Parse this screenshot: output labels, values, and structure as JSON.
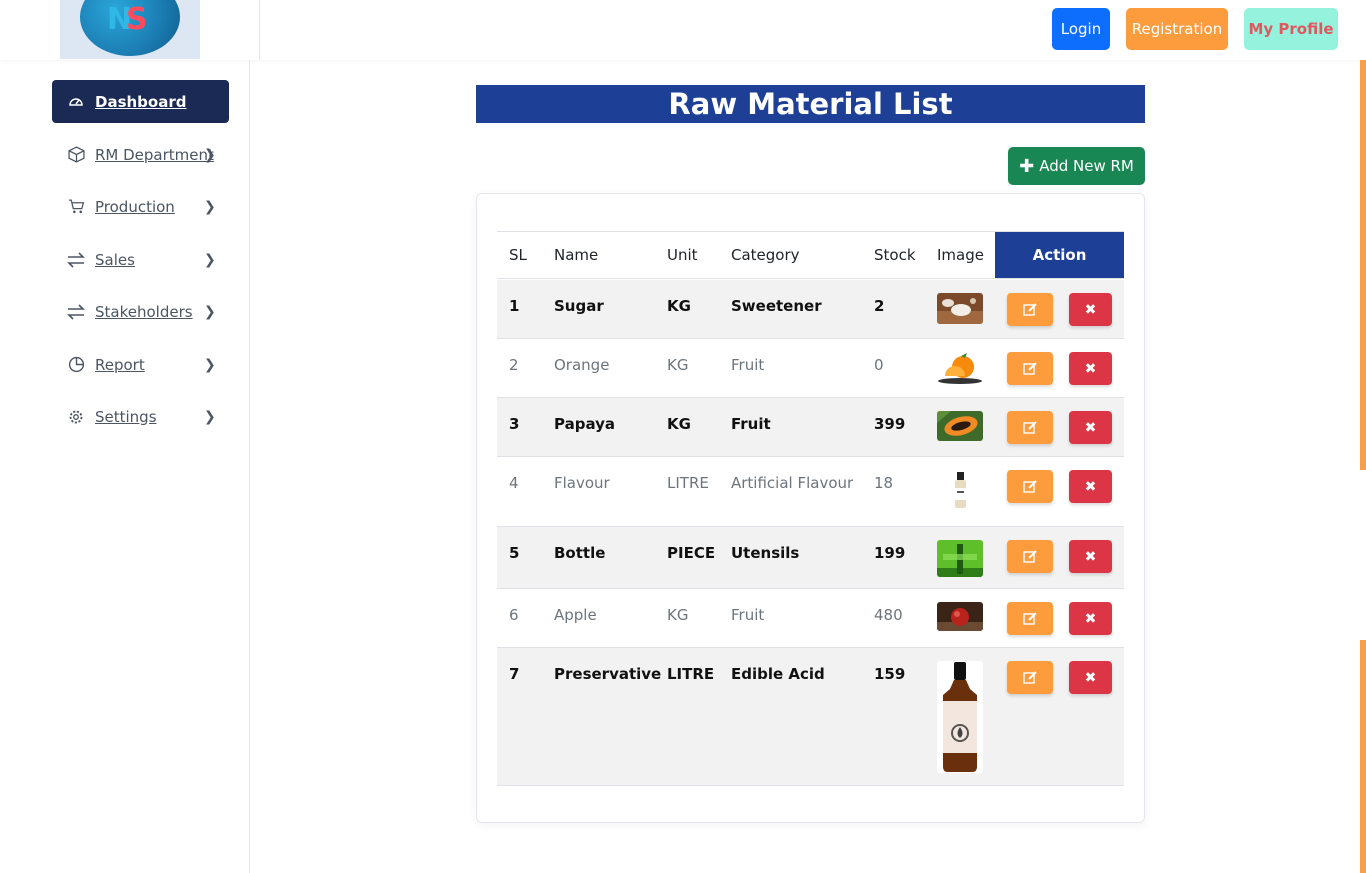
{
  "header": {
    "logo_letters": [
      "N",
      "S"
    ],
    "login_label": "Login",
    "registration_label": "Registration",
    "profile_label": "My Profile"
  },
  "sidebar": {
    "items": [
      {
        "label": "Dashboard",
        "icon": "gauge-icon",
        "active": true,
        "has_chevron": false
      },
      {
        "label": "RM Department",
        "icon": "box-icon",
        "active": false,
        "has_chevron": true
      },
      {
        "label": "Production",
        "icon": "cart-icon",
        "active": false,
        "has_chevron": true
      },
      {
        "label": "Sales",
        "icon": "arrows-swap-icon",
        "active": false,
        "has_chevron": true
      },
      {
        "label": "Stakeholders",
        "icon": "arrows-swap-icon",
        "active": false,
        "has_chevron": true
      },
      {
        "label": "Report",
        "icon": "pie-chart-icon",
        "active": false,
        "has_chevron": true
      },
      {
        "label": "Settings",
        "icon": "gear-icon",
        "active": false,
        "has_chevron": true
      }
    ]
  },
  "main": {
    "title": "Raw Material List",
    "add_button_label": "Add New RM",
    "table": {
      "headers": [
        "SL",
        "Name",
        "Unit",
        "Category",
        "Stock",
        "Image",
        "Action"
      ],
      "rows": [
        {
          "sl": "1",
          "name": "Sugar",
          "unit": "KG",
          "category": "Sweetener",
          "stock": "2",
          "image": "sugar-image"
        },
        {
          "sl": "2",
          "name": "Orange",
          "unit": "KG",
          "category": "Fruit",
          "stock": "0",
          "image": "orange-image"
        },
        {
          "sl": "3",
          "name": "Papaya",
          "unit": "KG",
          "category": "Fruit",
          "stock": "399",
          "image": "papaya-image"
        },
        {
          "sl": "4",
          "name": "Flavour",
          "unit": "LITRE",
          "category": "Artificial Flavour",
          "stock": "18",
          "image": "flavour-bottle-image"
        },
        {
          "sl": "5",
          "name": "Bottle",
          "unit": "PIECE",
          "category": "Utensils",
          "stock": "199",
          "image": "juice-bottle-image"
        },
        {
          "sl": "6",
          "name": "Apple",
          "unit": "KG",
          "category": "Fruit",
          "stock": "480",
          "image": "apple-image"
        },
        {
          "sl": "7",
          "name": "Preservative",
          "unit": "LITRE",
          "category": "Edible Acid",
          "stock": "159",
          "image": "amber-bottle-image"
        }
      ]
    }
  },
  "colors": {
    "title_bg": "#1e3f96",
    "sidebar_active": "#1b2a55",
    "edit": "#fd9c3c",
    "delete": "#dc3545",
    "add": "#198754"
  }
}
